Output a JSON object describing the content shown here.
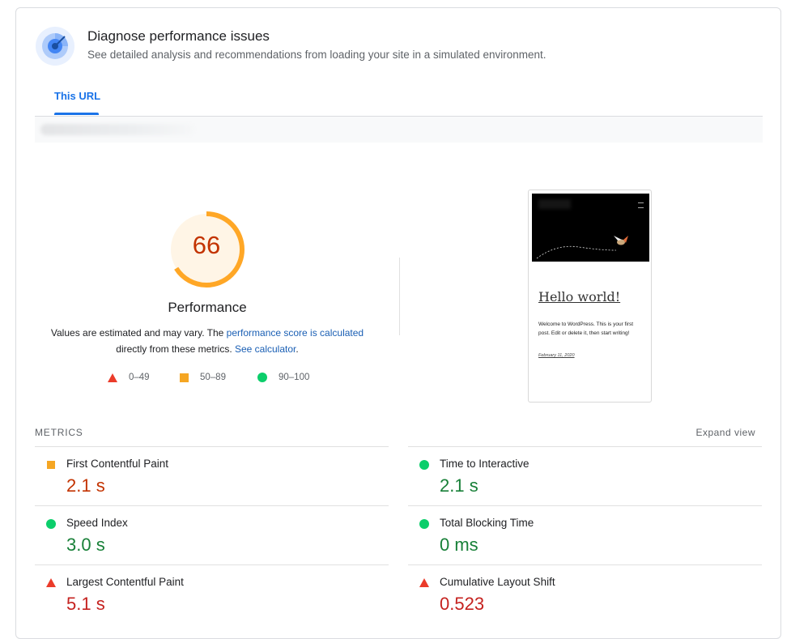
{
  "header": {
    "title": "Diagnose performance issues",
    "subtitle": "See detailed analysis and recommendations from loading your site in a simulated environment."
  },
  "tabs": [
    {
      "label": "This URL",
      "active": true
    }
  ],
  "performance": {
    "score": "66",
    "score_value": 66,
    "label": "Performance",
    "desc_before": "Values are estimated and may vary. The ",
    "desc_link1": "performance score is calculated",
    "desc_middle": " directly from these metrics. ",
    "desc_link2": "See calculator",
    "desc_after": "."
  },
  "legend": [
    {
      "range": "0–49",
      "shape": "triangle",
      "color": "#eb3b2a"
    },
    {
      "range": "50–89",
      "shape": "square",
      "color": "#f5a623"
    },
    {
      "range": "90–100",
      "shape": "circle",
      "color": "#0cce6b"
    }
  ],
  "screenshot_preview": {
    "title": "Hello world!",
    "body": "Welcome to WordPress. This is your first post. Edit or delete it, then start writing!",
    "date": "February 11, 2020"
  },
  "metrics": {
    "heading": "METRICS",
    "expand_label": "Expand view",
    "items": [
      {
        "name": "First Contentful Paint",
        "value": "2.1 s",
        "status": "average"
      },
      {
        "name": "Time to Interactive",
        "value": "2.1 s",
        "status": "good"
      },
      {
        "name": "Speed Index",
        "value": "3.0 s",
        "status": "good"
      },
      {
        "name": "Total Blocking Time",
        "value": "0 ms",
        "status": "good"
      },
      {
        "name": "Largest Contentful Paint",
        "value": "5.1 s",
        "status": "poor"
      },
      {
        "name": "Cumulative Layout Shift",
        "value": "0.523",
        "status": "poor"
      }
    ]
  },
  "colors": {
    "accent": "#1a73e8",
    "good": "#0cce6b",
    "average": "#f5a623",
    "poor": "#eb3b2a"
  }
}
